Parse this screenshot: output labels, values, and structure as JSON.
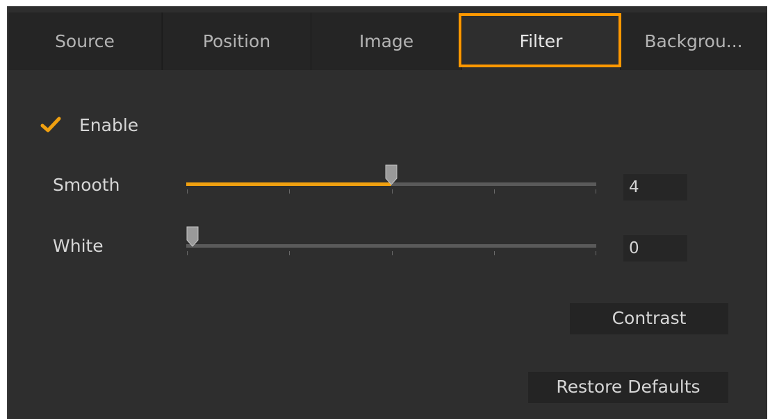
{
  "tabs": [
    {
      "label": "Source",
      "active": false
    },
    {
      "label": "Position",
      "active": false
    },
    {
      "label": "Image",
      "active": false
    },
    {
      "label": "Filter",
      "active": true
    },
    {
      "label": "Backgrou...",
      "active": false
    }
  ],
  "highlight_color": "#ff9800",
  "enable": {
    "label": "Enable",
    "checked": true,
    "icon": "checkmark-icon"
  },
  "smooth": {
    "label": "Smooth",
    "value": "4",
    "fraction": 0.5
  },
  "white": {
    "label": "White",
    "value": "0",
    "fraction": 0
  },
  "contrast_button": "Contrast",
  "restore_button": "Restore Defaults",
  "accent_color": "#f0a010"
}
